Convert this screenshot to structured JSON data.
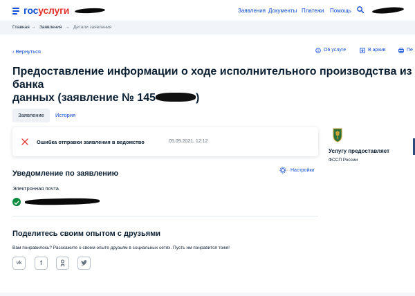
{
  "header": {
    "logo_part1": "гос",
    "logo_part2": "услуги",
    "nav": [
      "Заявления",
      "Документы",
      "Платежи",
      "Помощь"
    ]
  },
  "breadcrumb": [
    "Главная",
    "Заявления",
    "Детали заявления"
  ],
  "back_label": "Вернуться",
  "tools": [
    "О6 услуге",
    "В архив",
    "Пе"
  ],
  "title": {
    "line1": "Предоставление информации о ходе исполнительного производства из банка",
    "line2": "данных (заявление № 145"
  },
  "tabs": [
    "Заявление",
    "История"
  ],
  "status_card": {
    "message": "Ошибка отправки заявления в ведомство",
    "timestamp": "05.09.2021, 12:12"
  },
  "provider": {
    "label": "Услугу предоставляет",
    "name": "ФССП России"
  },
  "notification": {
    "heading": "Уведомление по заявлению",
    "settings_label": "Настройки",
    "channel": "Электронная почта"
  },
  "share": {
    "heading": "Поделитесь своим опытом с друзьями",
    "text": "Вам понравилось? Расскажите о своем опыте друзьям в социальных сетях. Пусть им понравится тоже!",
    "networks": [
      "vk-icon",
      "facebook-icon",
      "odnoklassniki-icon",
      "twitter-icon"
    ]
  },
  "colors": {
    "accent": "#0d4cd3",
    "brand_red": "#e1342c",
    "error": "#e1342c",
    "success": "#0a8a3f"
  }
}
